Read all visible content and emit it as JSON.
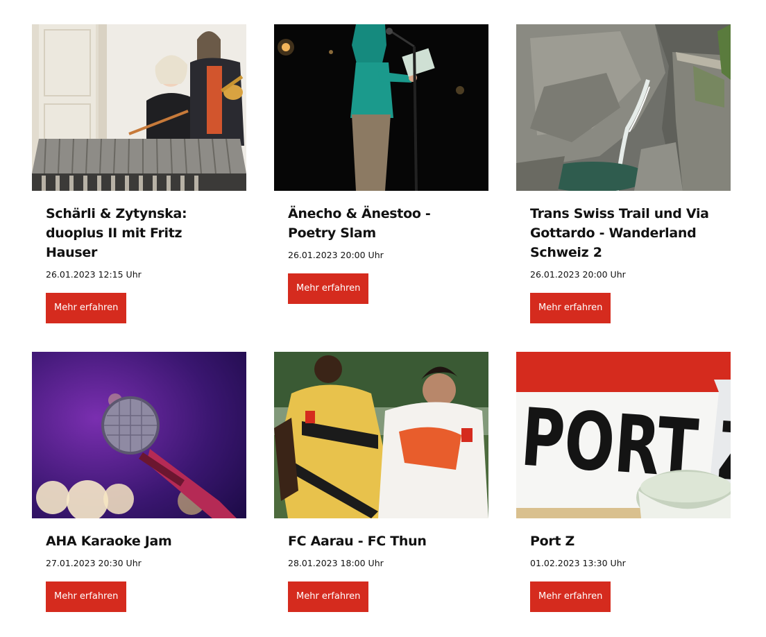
{
  "colors": {
    "accent": "#d52b1e"
  },
  "events": [
    {
      "title": "Schärli & Zytynska: duoplus II mit Fritz Hauser",
      "datetime": "26.01.2023 12:15 Uhr",
      "button_label": "Mehr erfahren",
      "image": "musicians-vibraphone-trumpet-photo"
    },
    {
      "title": "Änecho & Änestoo - Poetry Slam",
      "datetime": "26.01.2023 20:00 Uhr",
      "button_label": "Mehr erfahren",
      "image": "poetry-slam-stage-photo"
    },
    {
      "title": "Trans Swiss Trail und Via Gottardo - Wanderland Schweiz 2",
      "datetime": "26.01.2023 20:00 Uhr",
      "button_label": "Mehr erfahren",
      "image": "mountain-gorge-waterfall-photo"
    },
    {
      "title": "AHA Karaoke Jam",
      "datetime": "27.01.2023 20:30 Uhr",
      "button_label": "Mehr erfahren",
      "image": "microphone-purple-light-photo"
    },
    {
      "title": "FC Aarau - FC Thun",
      "datetime": "28.01.2023 18:00 Uhr",
      "button_label": "Mehr erfahren",
      "image": "football-players-photo"
    },
    {
      "title": "Port Z",
      "datetime": "01.02.2023 13:30 Uhr",
      "button_label": "Mehr erfahren",
      "image": "port-z-sign-photo",
      "image_text": "PORT Z"
    }
  ]
}
